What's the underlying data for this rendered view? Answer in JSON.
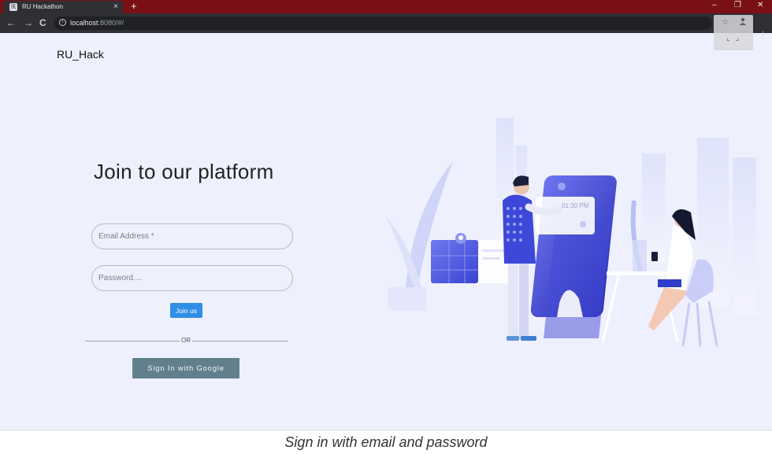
{
  "browser": {
    "tab_title": "RU Hackathon",
    "tab_close": "×",
    "new_tab": "+",
    "url_host": "localhost",
    "url_path": ":8080/#/",
    "win_min": "–",
    "win_max": "❐",
    "win_close": "✕",
    "back": "←",
    "forward": "→",
    "reload": "C",
    "star": "☆",
    "menu": "⋮",
    "fullscreen": "⌞ ⌟"
  },
  "page": {
    "brand": "RU_Hack",
    "headline": "Join to our platform",
    "email_placeholder": "Email Address *",
    "password_placeholder": "Password....",
    "join_label": "Join us",
    "or_label": "OR",
    "google_label": "Sign In with Google",
    "phone_time": "01:30 PM"
  },
  "caption": "Sign in with email and password",
  "colors": {
    "background": "#eef0fd",
    "primary_button": "#2f8fe6",
    "google_button": "#61808b",
    "tab_bar": "#7a1016",
    "illustration_blue": "#4b56e0"
  }
}
